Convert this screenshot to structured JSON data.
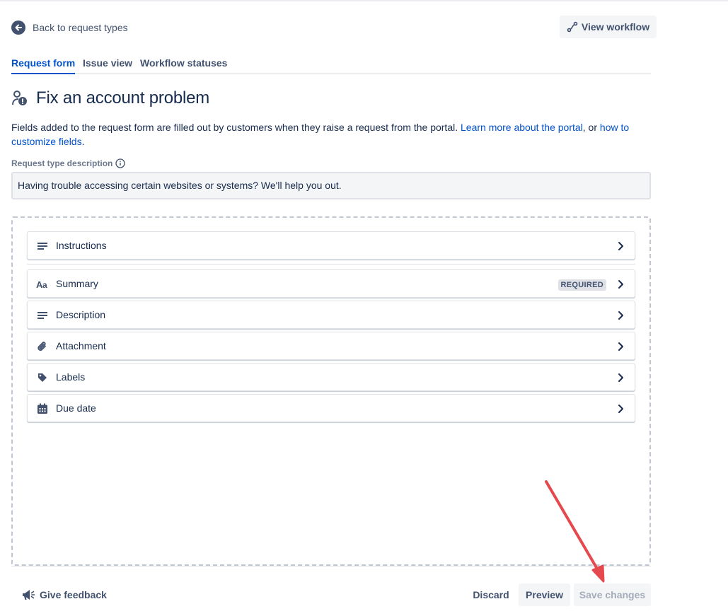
{
  "nav": {
    "back_label": "Back to request types",
    "view_workflow_label": "View workflow"
  },
  "tabs": [
    {
      "label": "Request form",
      "active": true
    },
    {
      "label": "Issue view",
      "active": false
    },
    {
      "label": "Workflow statuses",
      "active": false
    }
  ],
  "page": {
    "title": "Fix an account problem",
    "intro_text": "Fields added to the request form are filled out by customers when they raise a request from the portal.",
    "intro_link1": "Learn more about the portal",
    "intro_or": ", or",
    "intro_link2": "how to customize fields",
    "intro_end": ".",
    "description_label": "Request type description",
    "description_value": "Having trouble accessing certain websites or systems? We'll help you out."
  },
  "fields": [
    {
      "label": "Instructions",
      "icon": "text-lines-icon"
    },
    {
      "label": "Summary",
      "icon": "text-style-icon",
      "badge": "REQUIRED"
    },
    {
      "label": "Description",
      "icon": "text-lines-icon"
    },
    {
      "label": "Attachment",
      "icon": "paperclip-icon"
    },
    {
      "label": "Labels",
      "icon": "tag-icon"
    },
    {
      "label": "Due date",
      "icon": "calendar-icon"
    }
  ],
  "footer": {
    "feedback_label": "Give feedback",
    "discard_label": "Discard",
    "preview_label": "Preview",
    "save_label": "Save changes"
  },
  "colors": {
    "primary_link": "#0052cc",
    "text": "#172b4d",
    "subtle": "#42526e",
    "annotation_arrow": "#e5484d"
  }
}
